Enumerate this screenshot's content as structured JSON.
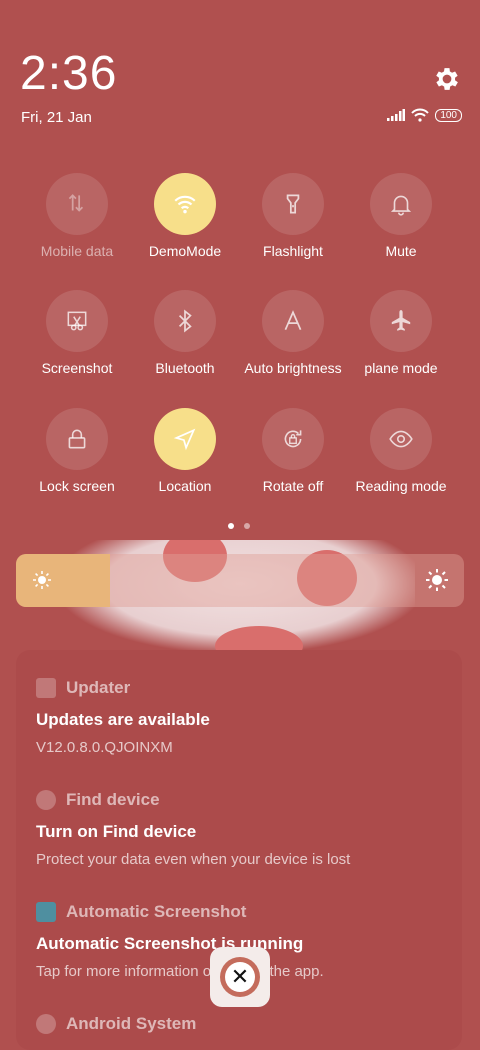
{
  "status_bar": {
    "time": "2:36",
    "date": "Fri, 21 Jan",
    "battery": "100"
  },
  "tiles": [
    {
      "label": "Mobile data",
      "icon": "mobile-data-icon",
      "state": "off"
    },
    {
      "label": "DemoMode",
      "icon": "wifi-icon",
      "state": "on"
    },
    {
      "label": "Flashlight",
      "icon": "flashlight-icon",
      "state": "off"
    },
    {
      "label": "Mute",
      "icon": "bell-icon",
      "state": "off"
    },
    {
      "label": "Screenshot",
      "icon": "scissors-icon",
      "state": "off"
    },
    {
      "label": "Bluetooth",
      "icon": "bluetooth-icon",
      "state": "off"
    },
    {
      "label": "Auto brightness",
      "icon": "font-a-icon",
      "state": "off"
    },
    {
      "label": "plane mode",
      "icon": "airplane-icon",
      "state": "off"
    },
    {
      "label": "Lock screen",
      "icon": "lock-icon",
      "state": "off"
    },
    {
      "label": "Location",
      "icon": "location-arrow-icon",
      "state": "on"
    },
    {
      "label": "Rotate off",
      "icon": "rotate-lock-icon",
      "state": "off"
    },
    {
      "label": "Reading mode",
      "icon": "eye-icon",
      "state": "off"
    }
  ],
  "page_indicator": {
    "current": 1,
    "total": 2
  },
  "brightness": {
    "level": 0.21
  },
  "notifications": [
    {
      "app": "Updater",
      "title": "Updates are available",
      "text": "V12.0.8.0.QJOINXM"
    },
    {
      "app": "Find device",
      "title": "Turn on Find device",
      "text": "Protect your data even when your device is lost"
    },
    {
      "app": "Automatic Screenshot",
      "title": "Automatic Screenshot is running",
      "text": "Tap for more information or to stop the app."
    },
    {
      "app": "Android System",
      "title": "",
      "text": ""
    }
  ],
  "colors": {
    "background": "#b0504f",
    "active_tile": "#f7df8a",
    "brightness_fill": "#e8b57a"
  }
}
